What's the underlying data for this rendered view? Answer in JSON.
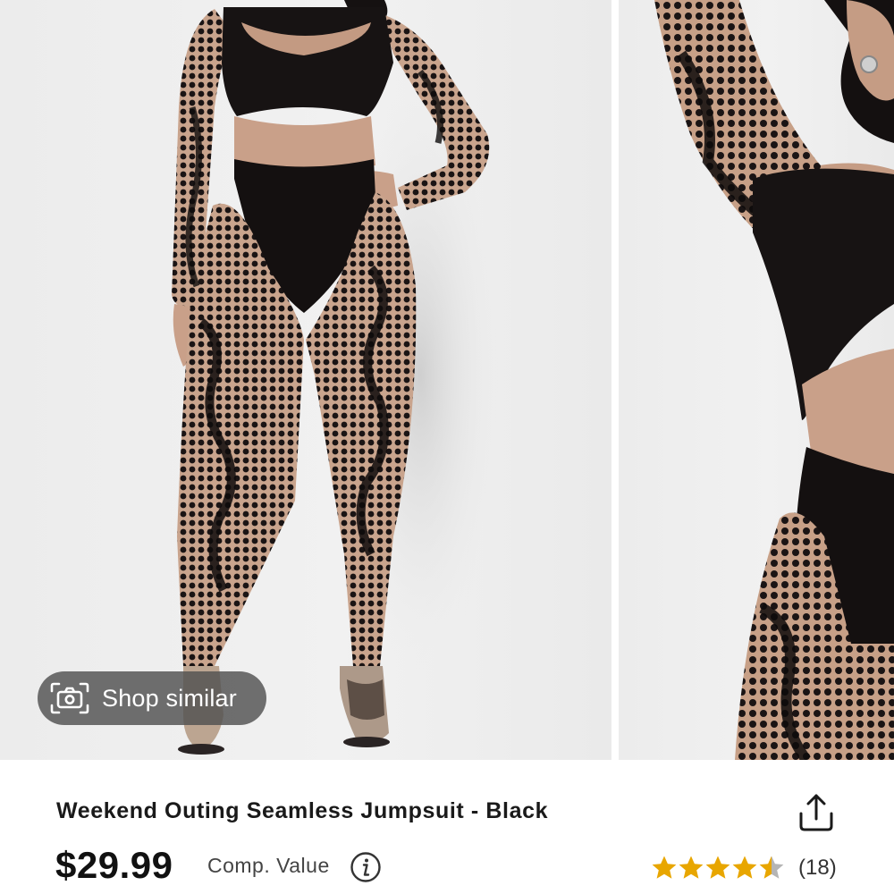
{
  "shop_similar": {
    "label": "Shop similar",
    "icon": "camera-icon"
  },
  "product": {
    "title": "Weekend Outing Seamless Jumpsuit - Black",
    "price": "$29.99",
    "comp_value_label": "Comp. Value",
    "info_icon": "info-icon",
    "share_icon": "share-icon"
  },
  "rating": {
    "stars": 4.5,
    "max_stars": 5,
    "review_count": "(18)",
    "star_color": "#e8a600",
    "empty_star_color": "#b5b5b5"
  },
  "colors": {
    "overlay_button": "#505050",
    "title_text": "#1a1a1a"
  }
}
